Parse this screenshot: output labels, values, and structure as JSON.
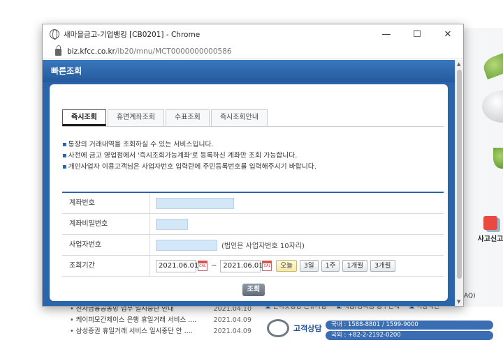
{
  "window": {
    "title": "새마을금고-기업뱅킹 [CB0201] - Chrome",
    "controls": {
      "minimize": "—",
      "maximize": "☐",
      "close": "✕"
    },
    "url_host": "biz.kfcc.co.kr",
    "url_path": "/ib20/mnu/MCT0000000000586"
  },
  "header": {
    "title": "빠른조회"
  },
  "tabs": [
    {
      "label": "즉시조회"
    },
    {
      "label": "휴면계좌조회"
    },
    {
      "label": "수표조회"
    },
    {
      "label": "즉시조회안내"
    }
  ],
  "notes": [
    "통장의 거래내역을 조회하실 수 있는 서비스입니다.",
    "사전에 금고 영업점에서 '즉시조회가능계좌'로 등록하신 계좌만 조회 가능합니다.",
    "개인사업자 이용고객님은 사업자번호 입력란에 주민등록번호를 입력해주시기 바랍니다."
  ],
  "form": {
    "account_label": "계좌번호",
    "password_label": "계좌비밀번호",
    "business_label": "사업자번호",
    "business_hint": "(법인은 사업자번호 10자리)",
    "period_label": "조회기간",
    "date_from": "2021.06.01",
    "date_to": "2021.06.01",
    "tilde": "~",
    "periods": {
      "today": "오늘",
      "d3": "3일",
      "w1": "1주",
      "m1": "1개월",
      "m3": "3개월"
    }
  },
  "search_button": "조회",
  "background": {
    "notices": [
      {
        "title": "전자금융공동망 업무 일시중단 안내",
        "date": "2021.04.10"
      },
      {
        "title": "케이피모간체이스 은행 휴일거래 서비스 ....",
        "date": "2021.04.09"
      },
      {
        "title": "삼성증권 휴일거래 서비스 일시중단 안 ....",
        "date": "2021.04.09"
      }
    ],
    "links": [
      "인터넷뱅킹 신규가입",
      "세금/공과금 납부안내",
      "이용약관"
    ],
    "customer_label": "고객상담",
    "phone_domestic": "국내 : 1588-8801 / 1599-9000",
    "phone_intl": "국외 : +82-2-2192-0200",
    "accident_label": "사고신고",
    "faq_text": "AQ)"
  }
}
